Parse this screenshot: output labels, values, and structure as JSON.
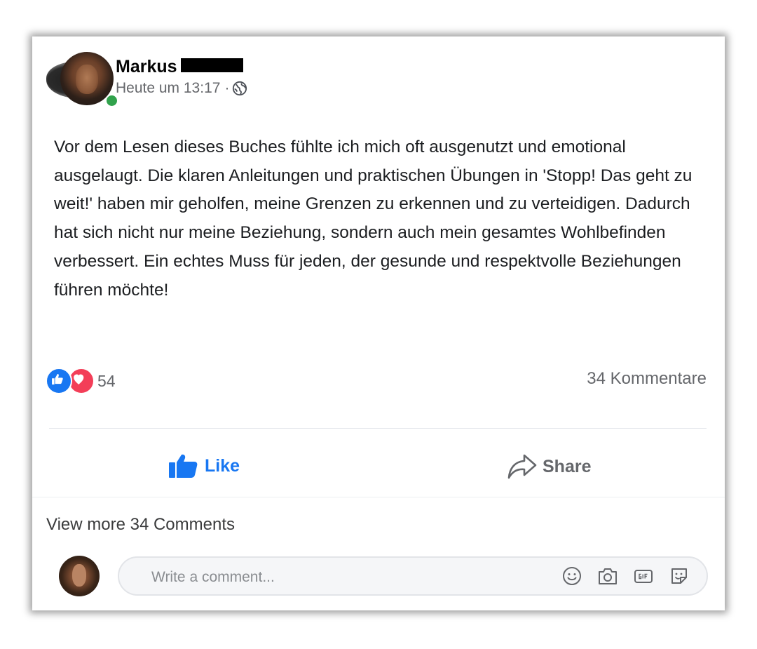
{
  "post": {
    "author_name": "Markus",
    "timestamp": "Heute um 13:17",
    "separator": "·",
    "privacy_icon": "globe-icon",
    "text": "Vor dem Lesen dieses Buches fühlte ich mich oft ausgenutzt und emotional ausgelaugt. Die klaren Anleitungen und praktischen Übungen in 'Stopp! Das geht zu weit!' haben mir geholfen, meine Grenzen zu erkennen und zu verteidigen. Dadurch hat sich nicht nur meine Beziehung, sondern auch mein gesamtes Wohlbefinden verbessert. Ein echtes Muss für jeden, der gesunde und respektvolle Beziehungen führen möchte!"
  },
  "reactions": {
    "icons": [
      "like-reaction-icon",
      "love-reaction-icon"
    ],
    "count": "54",
    "comments_count": "34 Kommentare"
  },
  "actions": {
    "like_label": "Like",
    "share_label": "Share"
  },
  "comments": {
    "view_more": "View more 34 Comments",
    "input_placeholder": "Write a comment...",
    "icons": [
      "emoji-icon",
      "camera-icon",
      "gif-icon",
      "sticker-icon"
    ]
  },
  "colors": {
    "accent": "#1877f2",
    "love": "#f33e58",
    "online": "#31a24c",
    "secondary_text": "#65676b"
  }
}
